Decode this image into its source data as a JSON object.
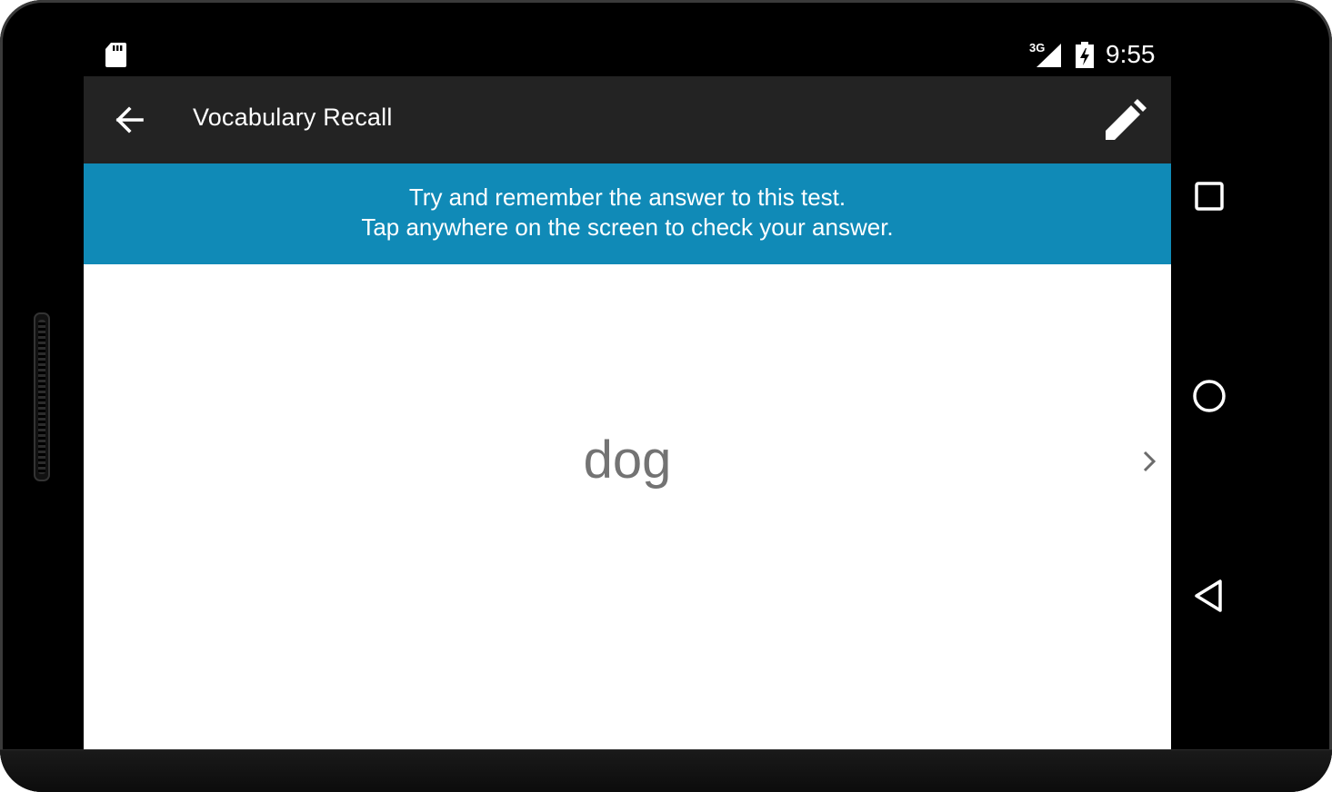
{
  "status_bar": {
    "network_type": "3G",
    "time": "9:55",
    "icons": [
      "sd-card-icon",
      "signal-icon",
      "battery-charging-icon"
    ]
  },
  "app_bar": {
    "title": "Vocabulary Recall",
    "back_icon": "arrow-back-icon",
    "edit_icon": "pencil-icon"
  },
  "hint": {
    "line1": "Try and remember the answer to this test.",
    "line2": "Tap anywhere on the screen to check your answer."
  },
  "card": {
    "word": "dog",
    "next_icon": "chevron-right-icon"
  },
  "nav_bar": {
    "buttons": [
      "recents-square-icon",
      "home-circle-icon",
      "back-triangle-icon"
    ]
  },
  "colors": {
    "app_bar": "#232323",
    "hint_banner": "#108ab7",
    "card_text": "#737373",
    "background": "#000000"
  }
}
